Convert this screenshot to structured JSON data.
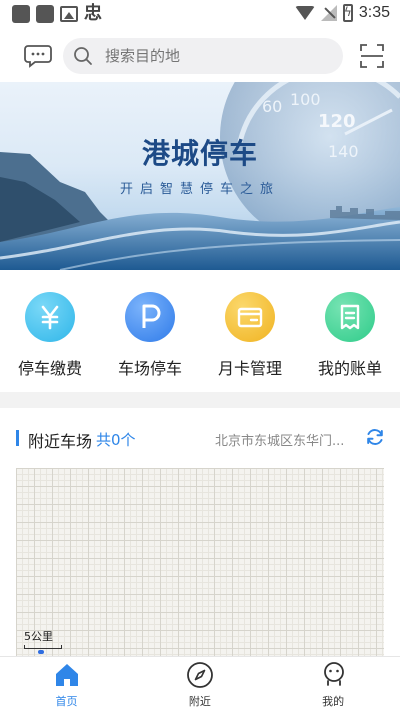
{
  "status_bar": {
    "time": "3:35",
    "left_glyph": "忠",
    "icons": [
      "app-square-icon",
      "app-square-icon",
      "image-icon",
      "wifi-icon",
      "signal-off-icon",
      "battery-charging-icon"
    ]
  },
  "header": {
    "message_icon": "chat-bubble-icon",
    "search_placeholder": "搜索目的地",
    "scan_icon": "scan-icon"
  },
  "banner": {
    "title": "港城停车",
    "subtitle": "开启智慧停车之旅"
  },
  "features": [
    {
      "label": "停车缴费",
      "icon": "yen-icon",
      "color": "#2fb6e9"
    },
    {
      "label": "车场停车",
      "icon": "parking-icon",
      "color": "#2f7be9"
    },
    {
      "label": "月卡管理",
      "icon": "card-icon",
      "color": "#f0b321"
    },
    {
      "label": "我的账单",
      "icon": "bill-icon",
      "color": "#2fcc8a"
    }
  ],
  "nearby": {
    "title": "附近车场",
    "count": "共0个",
    "location": "北京市东城区东华门...",
    "refresh_icon": "refresh-icon",
    "map_scale": "5公里"
  },
  "bottom_nav": [
    {
      "label": "首页",
      "icon": "home-icon",
      "active": true
    },
    {
      "label": "附近",
      "icon": "compass-icon",
      "active": false
    },
    {
      "label": "我的",
      "icon": "user-icon",
      "active": false
    }
  ],
  "colors": {
    "accent": "#2f86e8",
    "banner_title": "#1d4a86"
  }
}
